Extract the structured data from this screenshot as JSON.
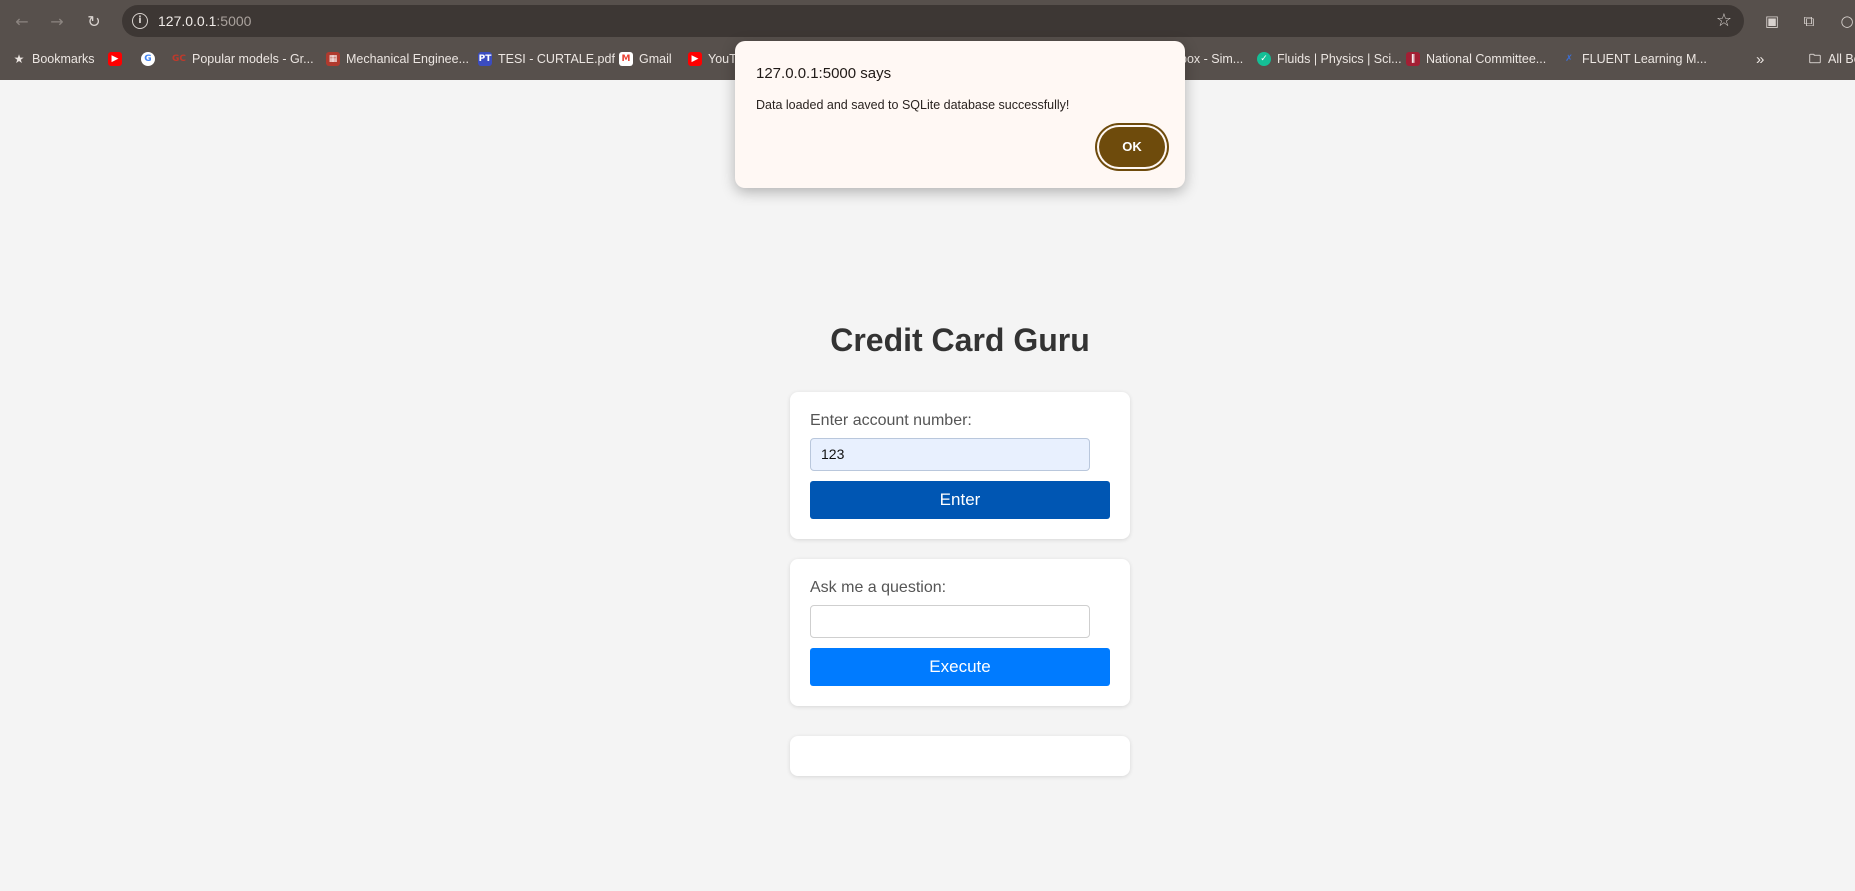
{
  "browser": {
    "url_host": "127.0.0.1",
    "url_port": ":5000",
    "bookmarks_label": "Bookmarks",
    "all_bookmarks_label": "All Bo",
    "bookmarks": [
      {
        "label": "",
        "icon": "youtube-icon",
        "color": "#ff0000"
      },
      {
        "label": "",
        "icon": "google-icon",
        "color": "#4285f4"
      },
      {
        "label": "Popular models - Gr...",
        "icon": "gc-icon",
        "color": "#c0392b"
      },
      {
        "label": "Mechanical Enginee...",
        "icon": "bookmark-favicon-icon",
        "color": "#b03a2e"
      },
      {
        "label": "TESI - CURTALE.pdf",
        "icon": "pt-icon",
        "color": "#3b4cc0"
      },
      {
        "label": "Gmail",
        "icon": "gmail-icon",
        "color": "#ea4335"
      },
      {
        "label": "YouT",
        "icon": "youtube-icon",
        "color": "#ff0000"
      },
      {
        "label": "box - Sim...",
        "icon": "",
        "color": ""
      },
      {
        "label": "Fluids | Physics | Sci...",
        "icon": "khan-academy-icon",
        "color": "#14bf96"
      },
      {
        "label": "National Committee...",
        "icon": "mit-icon",
        "color": "#a31f34"
      },
      {
        "label": "FLUENT Learning M...",
        "icon": "fluent-icon",
        "color": "#1f4e9a"
      }
    ]
  },
  "dialog": {
    "title": "127.0.0.1:5000 says",
    "message": "Data loaded and saved to SQLite database successfully!",
    "ok_label": "OK"
  },
  "page": {
    "title": "Credit Card Guru",
    "account_card": {
      "label": "Enter account number:",
      "input_value": "123",
      "button_label": "Enter",
      "button_color": "#0056b3"
    },
    "question_card": {
      "label": "Ask me a question:",
      "input_value": "",
      "button_label": "Execute",
      "button_color": "#007bff"
    },
    "result_card": {
      "content": ""
    }
  }
}
